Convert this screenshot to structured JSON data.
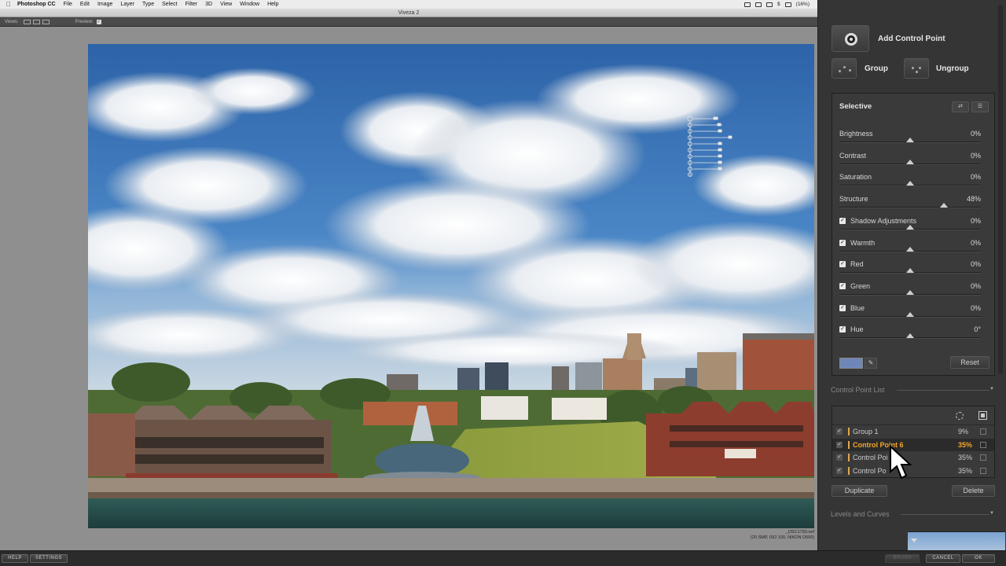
{
  "menubar": {
    "app_name": "Photoshop CC",
    "items": [
      "File",
      "Edit",
      "Image",
      "Layer",
      "Type",
      "Select",
      "Filter",
      "3D",
      "View",
      "Window",
      "Help"
    ],
    "battery": "(16%)"
  },
  "window_title": "Viveza 2",
  "toolbar": {
    "views_label": "Views:",
    "preview_label": "Preview:"
  },
  "panel": {
    "add_control_point": "Add Control Point",
    "group": "Group",
    "ungroup": "Ungroup",
    "selective_title": "Selective",
    "sliders": [
      {
        "label": "Brightness",
        "value": "0%",
        "checkbox": false,
        "position": 0.5
      },
      {
        "label": "Contrast",
        "value": "0%",
        "checkbox": false,
        "position": 0.5
      },
      {
        "label": "Saturation",
        "value": "0%",
        "checkbox": false,
        "position": 0.5
      },
      {
        "label": "Structure",
        "value": "48%",
        "checkbox": false,
        "position": 0.74
      },
      {
        "label": "Shadow Adjustments",
        "value": "0%",
        "checkbox": true,
        "position": 0.5
      },
      {
        "label": "Warmth",
        "value": "0%",
        "checkbox": true,
        "position": 0.5
      },
      {
        "label": "Red",
        "value": "0%",
        "checkbox": true,
        "position": 0.5
      },
      {
        "label": "Green",
        "value": "0%",
        "checkbox": true,
        "position": 0.5
      },
      {
        "label": "Blue",
        "value": "0%",
        "checkbox": true,
        "position": 0.5
      },
      {
        "label": "Hue",
        "value": "0°",
        "checkbox": true,
        "position": 0.5
      }
    ],
    "reset": "Reset",
    "swatch_color": "#6e86b8",
    "control_point_list_title": "Control Point List",
    "control_points": [
      {
        "name": "Group 1",
        "pct": "9%",
        "selected": false
      },
      {
        "name": "Control Point 6",
        "pct": "35%",
        "selected": true
      },
      {
        "name": "Control Poi",
        "pct": "35%",
        "selected": false
      },
      {
        "name": "Control Po",
        "pct": "35%",
        "selected": false
      }
    ],
    "duplicate": "Duplicate",
    "delete": "Delete",
    "levels_curves_title": "Levels and Curves"
  },
  "file_info": {
    "filename": "_DSC1793.nef",
    "details": "(20 SMP, ISO 100, NIKON D500)"
  },
  "bottom_buttons": {
    "help": "HELP",
    "settings": "SETTINGS",
    "brush": "BRUSH",
    "cancel": "CANCEL",
    "ok": "OK"
  },
  "colors": {
    "accent": "#f3a62c",
    "panel_bg": "#353535"
  }
}
